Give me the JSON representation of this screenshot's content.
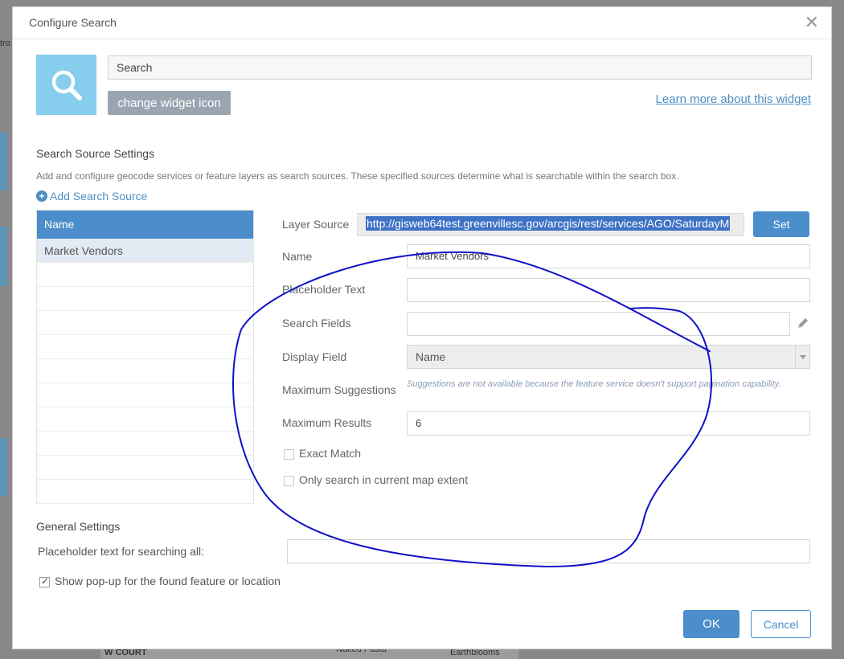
{
  "dialog": {
    "title": "Configure Search",
    "close_glyph": "✕"
  },
  "widget": {
    "icon": "search-icon",
    "name_value": "Search",
    "change_icon_label": "change widget icon",
    "learn_more_label": "Learn more about this widget"
  },
  "source_settings": {
    "title": "Search Source Settings",
    "description": "Add and configure geocode services or feature layers as search sources. These specified sources determine what is searchable within the search box.",
    "add_label": "Add Search Source",
    "list_header": "Name",
    "list_items": [
      "Market Vendors"
    ]
  },
  "form": {
    "layer_source_label": "Layer Source",
    "layer_source_value": "http://gisweb64test.greenvillesc.gov/arcgis/rest/services/AGO/SaturdayM",
    "set_label": "Set",
    "name_label": "Name",
    "name_value": "Market Vendors",
    "placeholder_label": "Placeholder Text",
    "placeholder_value": "",
    "search_fields_label": "Search Fields",
    "search_fields_value": "",
    "display_field_label": "Display Field",
    "display_field_value": "Name",
    "max_suggestions_label": "Maximum Suggestions",
    "max_suggestions_hint": "Suggestions are not available because the feature service doesn't support pagination capability.",
    "max_results_label": "Maximum Results",
    "max_results_value": "6",
    "exact_match_label": "Exact Match",
    "exact_match_checked": false,
    "current_extent_label": "Only search in current map extent",
    "current_extent_checked": false
  },
  "general_settings": {
    "title": "General Settings",
    "placeholder_all_label": "Placeholder text for searching all:",
    "placeholder_all_value": "",
    "show_popup_label": "Show pop-up for the found feature or location",
    "show_popup_checked": true
  },
  "buttons": {
    "ok_label": "OK",
    "cancel_label": "Cancel"
  },
  "background": {
    "map_left_text": "tro",
    "map_label_1": "Naked Pasta",
    "map_label_2": "Earthblooms",
    "map_label_3": "W COURT"
  },
  "colors": {
    "accent": "#4b8ecb",
    "widget_icon_bg": "#87cded",
    "annotation_stroke": "#1010c8"
  }
}
